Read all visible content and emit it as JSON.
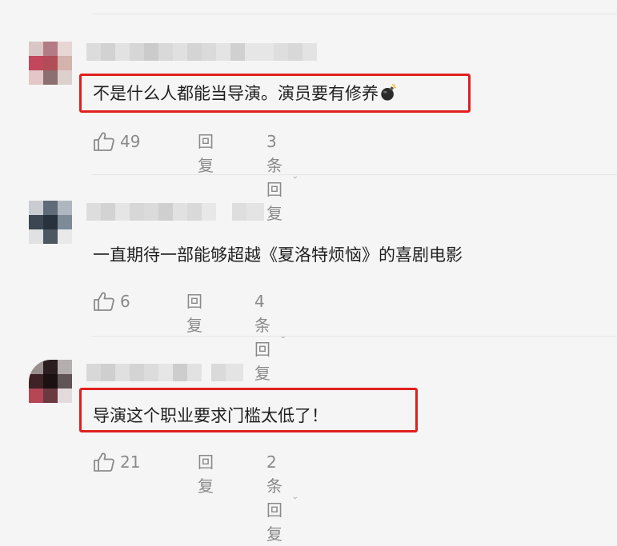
{
  "comments": [
    {
      "text": "不是什么人都能当导演。演员要有修养",
      "emoji": "bomb-emoji",
      "likes": "49",
      "reply_label": "回复",
      "replies_label": "3条回复",
      "highlighted": true
    },
    {
      "text": "一直期待一部能够超越《夏洛特烦恼》的喜剧电影",
      "likes": "6",
      "reply_label": "回复",
      "replies_label": "4条回复",
      "highlighted": false
    },
    {
      "text": "导演这个职业要求门槛太低了！",
      "likes": "21",
      "reply_label": "回复",
      "replies_label": "2条回复",
      "highlighted": true
    }
  ],
  "colors": {
    "highlight_border": "#e0201e",
    "action_text": "#8a8a8a",
    "background": "#f5f5f5"
  },
  "icons": {
    "like": "thumbs-up-icon",
    "expand": "chevron-down-icon"
  }
}
